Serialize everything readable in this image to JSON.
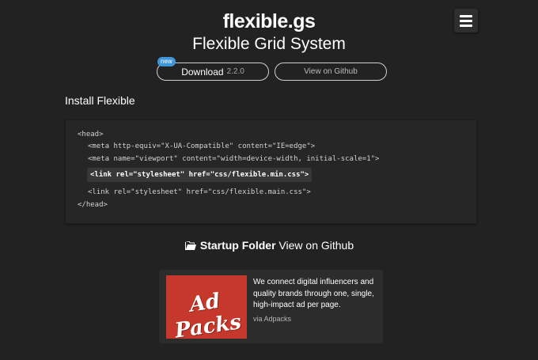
{
  "header": {
    "logo": "flexible.gs",
    "subtitle": "Flexible Grid System",
    "menu_icon": "hamburger-menu-icon"
  },
  "actions": {
    "badge": "new",
    "download_label": "Download",
    "download_version": "2.2.0",
    "github_label": "View on Github"
  },
  "install": {
    "title": "Install Flexible",
    "code_lines": [
      "<head>",
      "<meta http-equiv=\"X-UA-Compatible\" content=\"IE=edge\">",
      "<meta name=\"viewport\" content=\"width=device-width, initial-scale=1\">",
      "<link rel=\"stylesheet\" href=\"css/flexible.min.css\">",
      "<link rel=\"stylesheet\" href=\"css/flexible.main.css\">",
      "</head>"
    ]
  },
  "startup": {
    "icon": "folder-open-icon",
    "bold_label": "Startup Folder",
    "link_label": "View on Github"
  },
  "ad": {
    "image_text": "Ad Packs",
    "body": "We connect digital influencers and quality brands through one, single, high-impact ad per page.",
    "via": "via Adpacks"
  }
}
